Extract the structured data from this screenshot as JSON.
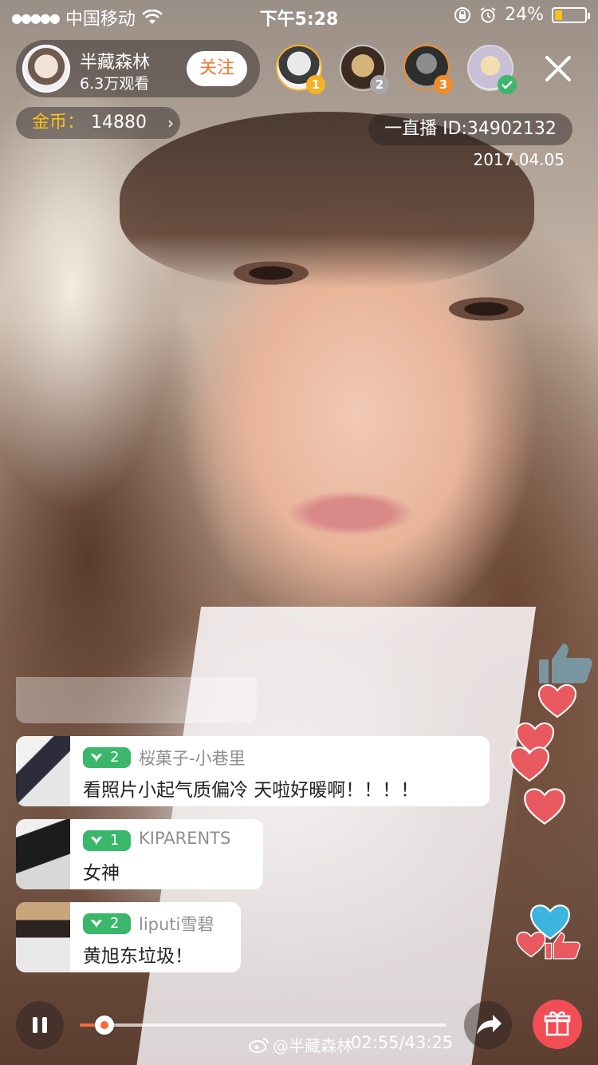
{
  "status_bar": {
    "signal": "●●●●●",
    "carrier": "中国移动",
    "time": "下午5:28",
    "battery_percent": "24%",
    "battery_level": 0.24
  },
  "host": {
    "name": "半藏森林",
    "views": "6.3万观看",
    "follow_label": "关注"
  },
  "viewers": [
    {
      "rank": "1"
    },
    {
      "rank": "2"
    },
    {
      "rank": "3"
    },
    {
      "rank": ""
    }
  ],
  "coins": {
    "label": "金币：",
    "value": "14880",
    "chevron": "›"
  },
  "live": {
    "id_text": "一直播 ID:34902132",
    "date": "2017.04.05"
  },
  "chat": [
    {
      "level": "2",
      "name": "桜菓子-小巷里",
      "text": "看照片小起气质偏冷 天啦好暖啊！！！！"
    },
    {
      "level": "1",
      "name": "KIPARENTS",
      "text": "女神"
    },
    {
      "level": "2",
      "name": "liputi雪碧",
      "text": "黄旭东垃圾！"
    }
  ],
  "playback": {
    "current": "02:55",
    "total": "43:25",
    "readout": "02:55/43:25",
    "progress": 0.067,
    "watermark": "@半藏森林"
  },
  "colors": {
    "accent": "#f26b3a",
    "follow": "#ef7a30",
    "level_badge": "#3ab76b",
    "coins_label": "#f7c21a",
    "gift": "#f04d55",
    "heart": "#e85a5f"
  },
  "icons": [
    "wifi-icon",
    "lock-rotation-icon",
    "alarm-icon",
    "battery-icon",
    "close-icon",
    "chevron-right-icon",
    "leaf-icon",
    "pause-icon",
    "share-icon",
    "gift-icon",
    "heart-icon",
    "thumbs-up-icon",
    "weibo-icon"
  ]
}
